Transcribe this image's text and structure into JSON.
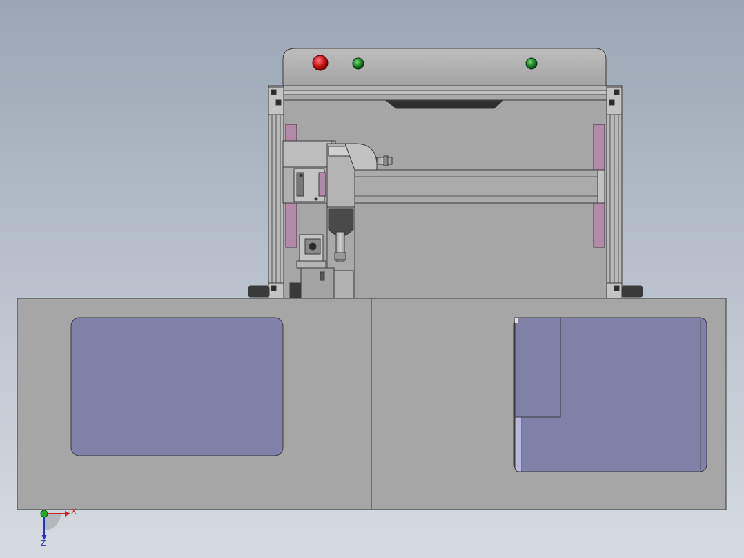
{
  "triad": {
    "x_label": "X",
    "z_label": "Z"
  },
  "colors": {
    "body": "#a6a6a6",
    "outline": "#3a3a3a",
    "panel": "#8080a8",
    "panel_light": "#b7b7dc",
    "rail_pink": "#b08aa6",
    "button_red": "#cc1a1a",
    "button_green": "#1f8a2a",
    "axis_x": "#cc2222",
    "axis_y": "#22aa22",
    "axis_z": "#2233cc"
  },
  "icons": [
    "emergency-stop-icon",
    "start-button-icon",
    "indicator-light-icon",
    "coordinate-triad-icon"
  ]
}
